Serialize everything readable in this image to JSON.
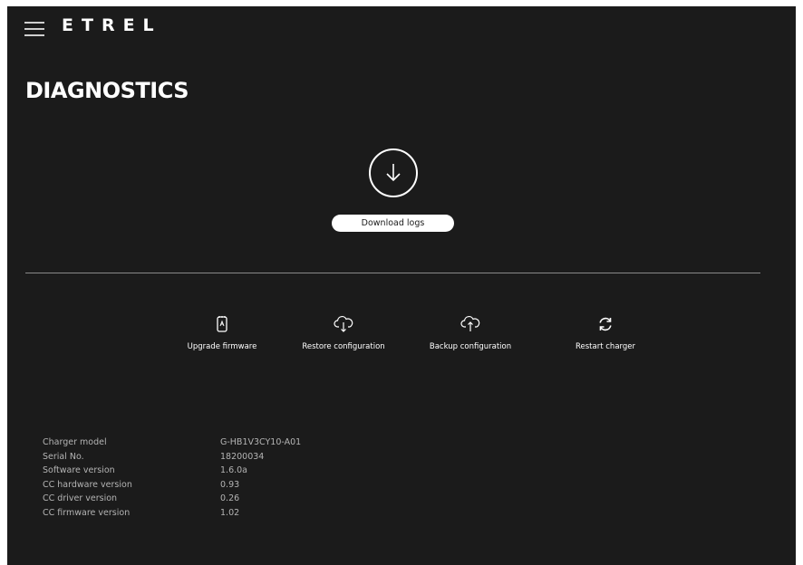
{
  "header": {
    "logo_text": "ETREL"
  },
  "page": {
    "title": "DIAGNOSTICS"
  },
  "download": {
    "button_label": "Download logs"
  },
  "actions": [
    {
      "label": "Upgrade firmware",
      "icon": "firmware-chip-icon"
    },
    {
      "label": "Restore configuration",
      "icon": "cloud-download-icon"
    },
    {
      "label": "Backup configuration",
      "icon": "cloud-upload-icon"
    },
    {
      "label": "Restart charger",
      "icon": "restart-icon"
    }
  ],
  "info": [
    {
      "label": "Charger model",
      "value": "G-HB1V3CY10-A01"
    },
    {
      "label": "Serial No.",
      "value": "18200034"
    },
    {
      "label": "Software version",
      "value": "1.6.0a"
    },
    {
      "label": "CC hardware version",
      "value": "0.93"
    },
    {
      "label": "CC driver version",
      "value": "0.26"
    },
    {
      "label": "CC firmware version",
      "value": "1.02"
    }
  ],
  "colors": {
    "background": "#1b1b1b",
    "text": "#ffffff",
    "muted_text": "#b4b4b4",
    "divider": "#8a8a8a"
  }
}
